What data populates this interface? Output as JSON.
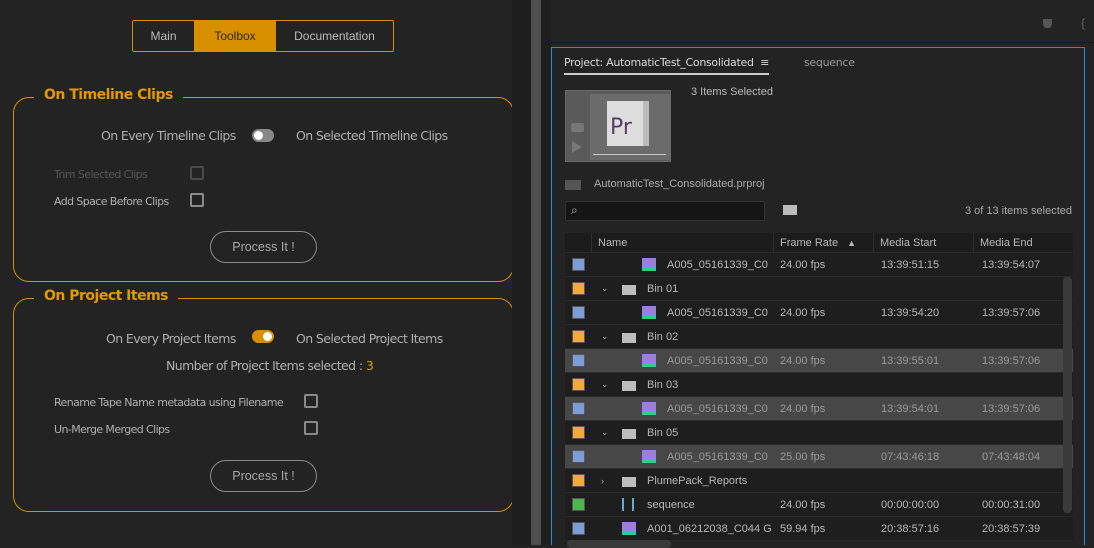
{
  "tabs": [
    "Main",
    "Toolbox",
    "Documentation"
  ],
  "timeline": {
    "title": "On Timeline Clips",
    "left_label": "On Every Timeline Clips",
    "right_label": "On Selected Timeline Clips",
    "toggle_on": false,
    "options": [
      {
        "label": "Trim Selected Clips",
        "checked": false,
        "disabled": true
      },
      {
        "label": "Add Space Before Clips",
        "checked": false
      }
    ],
    "button": "Process It !"
  },
  "project": {
    "title": "On Project Items",
    "left_label": "On Every Project Items",
    "right_label": "On Selected Project Items",
    "toggle_on": true,
    "count_label": "Number of Project Items selected : ",
    "count": "3",
    "options": [
      {
        "label": "Rename Tape Name metadata using Filename",
        "checked": false
      },
      {
        "label": "Un-Merge Merged Clips",
        "checked": false
      }
    ],
    "button": "Process It !"
  },
  "panel": {
    "tab_project": "Project: AutomaticTest_Consolidated",
    "tab_menu": "≡",
    "tab_sequence": "sequence",
    "selection_title": "3 Items Selected",
    "thumb_label": "Pr",
    "project_file": "AutomaticTest_Consolidated.prproj",
    "search_placeholder": "",
    "selected_count": "3 of 13 items selected"
  },
  "table": {
    "columns": [
      "Name",
      "Frame Rate",
      "Media Start",
      "Media End"
    ],
    "sort_indicator": "▲",
    "rows": [
      {
        "type": "clip",
        "indent": 2,
        "color": "#7b9fd4",
        "name": "A005_05161339_C0",
        "fr": "24.00 fps",
        "ms": "13:39:51:15",
        "me": "13:39:54:07",
        "sel": false
      },
      {
        "type": "bin",
        "indent": 1,
        "color": "#f2a83c",
        "name": "Bin 01",
        "open": true
      },
      {
        "type": "clip",
        "indent": 2,
        "color": "#7b9fd4",
        "name": "A005_05161339_C0",
        "fr": "24.00 fps",
        "ms": "13:39:54:20",
        "me": "13:39:57:06",
        "sel": false
      },
      {
        "type": "bin",
        "indent": 1,
        "color": "#f2a83c",
        "name": "Bin 02",
        "open": true
      },
      {
        "type": "clip",
        "indent": 2,
        "color": "#7b9fd4",
        "name": "A005_05161339_C0",
        "fr": "24.00 fps",
        "ms": "13:39:55:01",
        "me": "13:39:57:06",
        "sel": true
      },
      {
        "type": "bin",
        "indent": 1,
        "color": "#f2a83c",
        "name": "Bin 03",
        "open": true
      },
      {
        "type": "clip",
        "indent": 2,
        "color": "#7b9fd4",
        "name": "A005_05161339_C0",
        "fr": "24.00 fps",
        "ms": "13:39:54:01",
        "me": "13:39:57:06",
        "sel": true
      },
      {
        "type": "bin",
        "indent": 1,
        "color": "#f2a83c",
        "name": "Bin 05",
        "open": true
      },
      {
        "type": "clip",
        "indent": 2,
        "color": "#7b9fd4",
        "name": "A005_05161339_C0",
        "fr": "25.00 fps",
        "ms": "07:43:46:18",
        "me": "07:43:48:04",
        "sel": true
      },
      {
        "type": "bin",
        "indent": 1,
        "color": "#f2a83c",
        "name": "PlumePack_Reports",
        "open": false
      },
      {
        "type": "seq",
        "indent": 1,
        "color": "#4cb84c",
        "name": "sequence",
        "fr": "24.00 fps",
        "ms": "00:00:00:00",
        "me": "00:00:31:00",
        "sel": false
      },
      {
        "type": "clip",
        "indent": 1,
        "color": "#7b9fd4",
        "name": "A001_06212038_C044 G",
        "fr": "59.94 fps",
        "ms": "20:38:57:16",
        "me": "20:38:57:39",
        "sel": false
      }
    ]
  }
}
